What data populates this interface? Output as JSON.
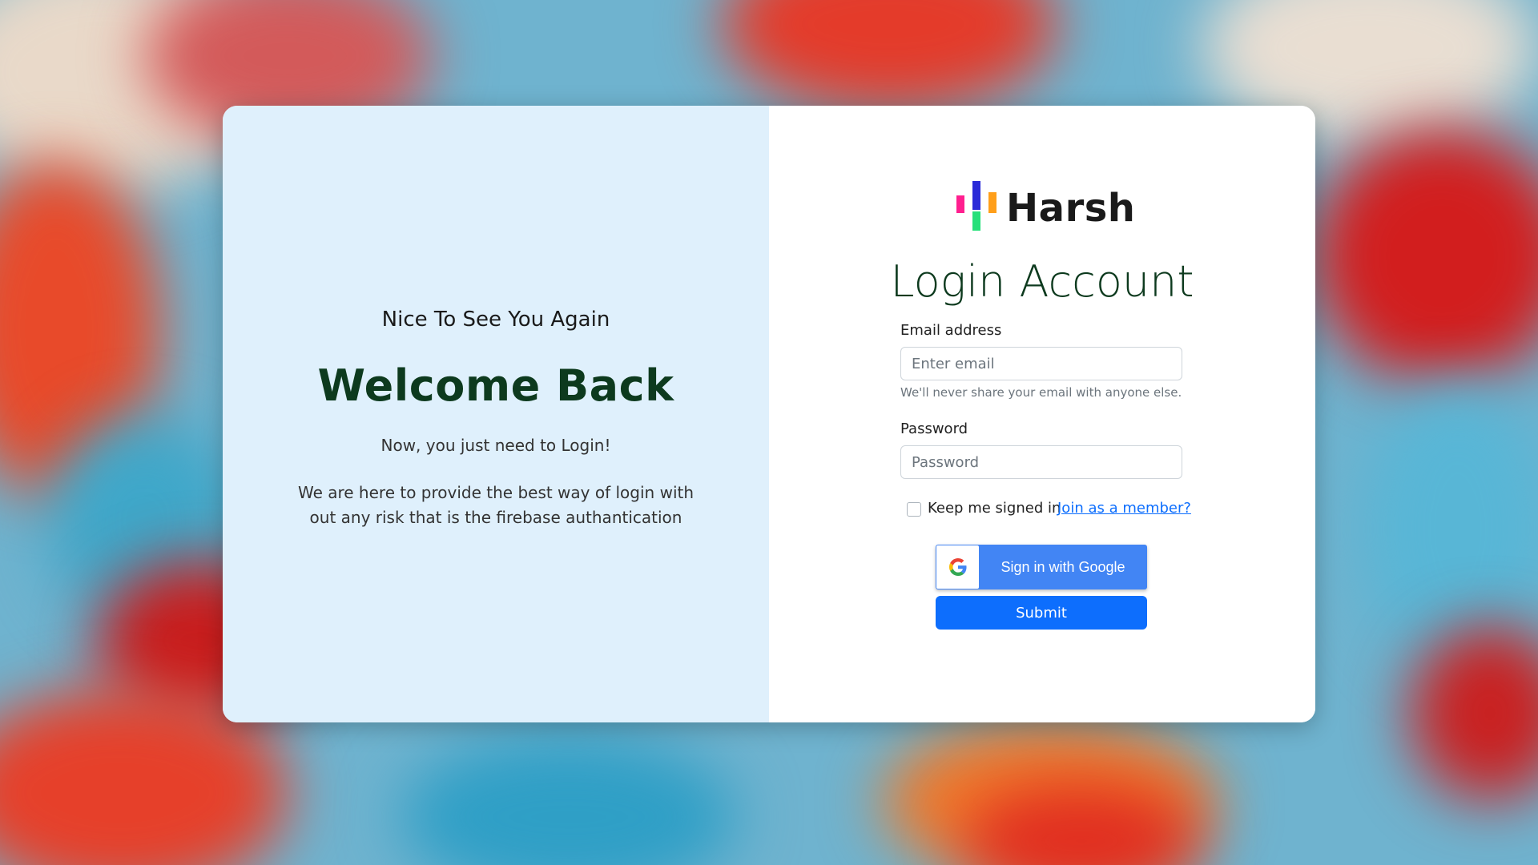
{
  "brand": {
    "name": "Harsh",
    "colors": {
      "accent": "#0d6efd",
      "google": "#4285f4",
      "heading": "#0d3a1e",
      "left_panel": "#dff0fc"
    }
  },
  "left": {
    "greeting": "Nice To See You Again",
    "title": "Welcome Back",
    "subtitle": "Now, you just need to Login!",
    "description": "We are here to provide the best way of login with out any risk that is the firebase authantication"
  },
  "form": {
    "title": "Login Account",
    "email": {
      "label": "Email address",
      "placeholder": "Enter email",
      "value": "",
      "help": "We'll never share your email with anyone else."
    },
    "password": {
      "label": "Password",
      "placeholder": "Password",
      "value": ""
    },
    "remember": {
      "label": "Keep me signed in",
      "checked": false
    },
    "join_link": "Join as a member?",
    "google_button": "Sign in with Google",
    "google_icon": "google-g-icon",
    "submit": "Submit"
  }
}
